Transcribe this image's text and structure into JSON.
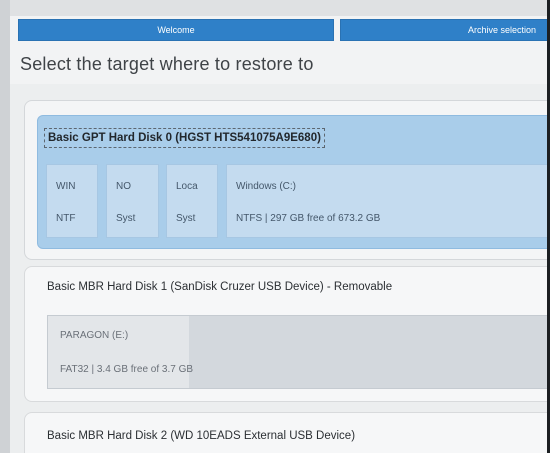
{
  "steps": {
    "welcome": "Welcome",
    "archive_selection": "Archive selection"
  },
  "page_title": "Select the target where to restore to",
  "disks": [
    {
      "title": "Basic GPT Hard Disk 0 (HGST HTS541075A9E680)",
      "selected": true,
      "partitions": [
        {
          "name": "WIN",
          "fs": "NTF"
        },
        {
          "name": "NO",
          "fs": "Syst"
        },
        {
          "name": "Loca",
          "fs": "Syst"
        },
        {
          "name": "Windows (C:)",
          "fs": "NTFS | 297 GB free of 673.2 GB"
        }
      ]
    },
    {
      "title": "Basic MBR Hard Disk 1 (SanDisk Cruzer USB Device) - Removable",
      "selected": false,
      "partitions": [
        {
          "name": "PARAGON (E:)",
          "fs": "FAT32 | 3.4 GB free of 3.7 GB",
          "used_fraction": 0.08
        }
      ]
    },
    {
      "title": "Basic MBR Hard Disk 2 (WD 10EADS External USB Device)",
      "selected": false,
      "partitions": []
    }
  ],
  "colors": {
    "accent": "#2f80c8",
    "selected_panel": "#a9cdea",
    "selected_partition": "#c4dbef",
    "unselected_partition": "#d3d8dd"
  }
}
